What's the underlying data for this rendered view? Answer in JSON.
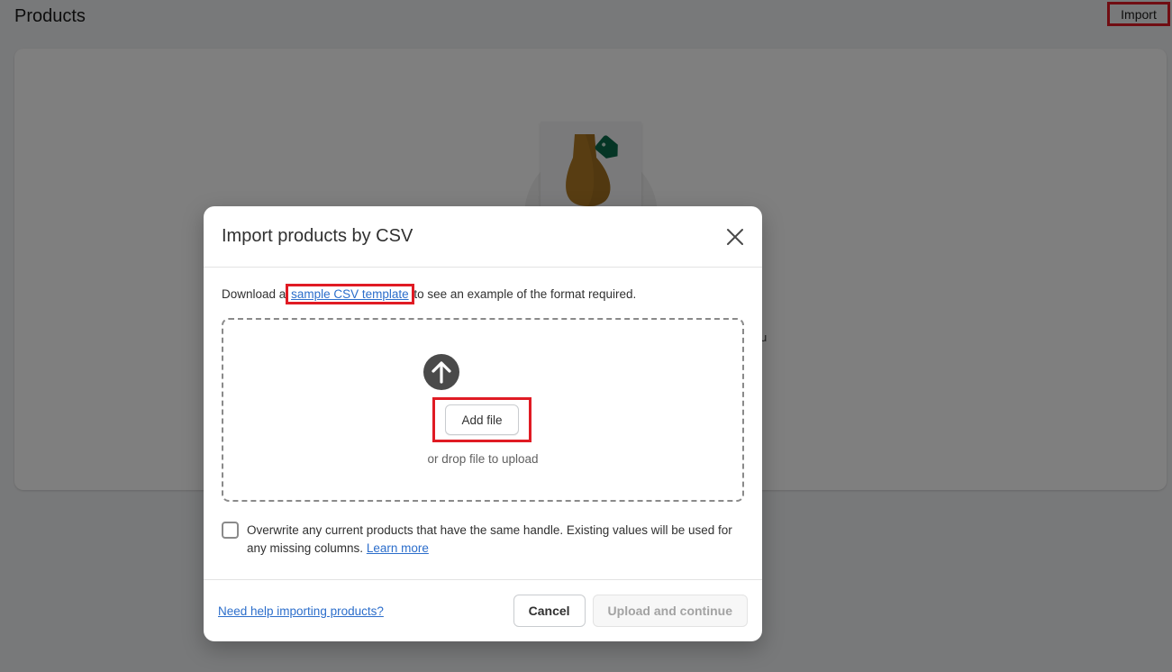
{
  "page": {
    "title": "Products",
    "import_label": "Import",
    "partial_text": "u"
  },
  "modal": {
    "title": "Import products by CSV",
    "intro_prefix": "Download a ",
    "intro_link": "sample CSV template",
    "intro_suffix": " to see an example of the format required.",
    "add_file_label": "Add file",
    "drop_hint": "or drop file to upload",
    "overwrite_text": "Overwrite any current products that have the same handle. Existing values will be used for any missing columns. ",
    "learn_more_label": "Learn more",
    "overwrite_checked": false,
    "help_link": "Need help importing products?",
    "cancel_label": "Cancel",
    "upload_label": "Upload and continue"
  },
  "icons": {
    "close": "close-icon",
    "upload": "upload-arrow-icon",
    "illustration": "vase-with-tag-illustration"
  },
  "colors": {
    "highlight": "#e01b24",
    "link": "#2c6ecb",
    "tag": "#0b6b4a",
    "vase": "#b07a24"
  }
}
